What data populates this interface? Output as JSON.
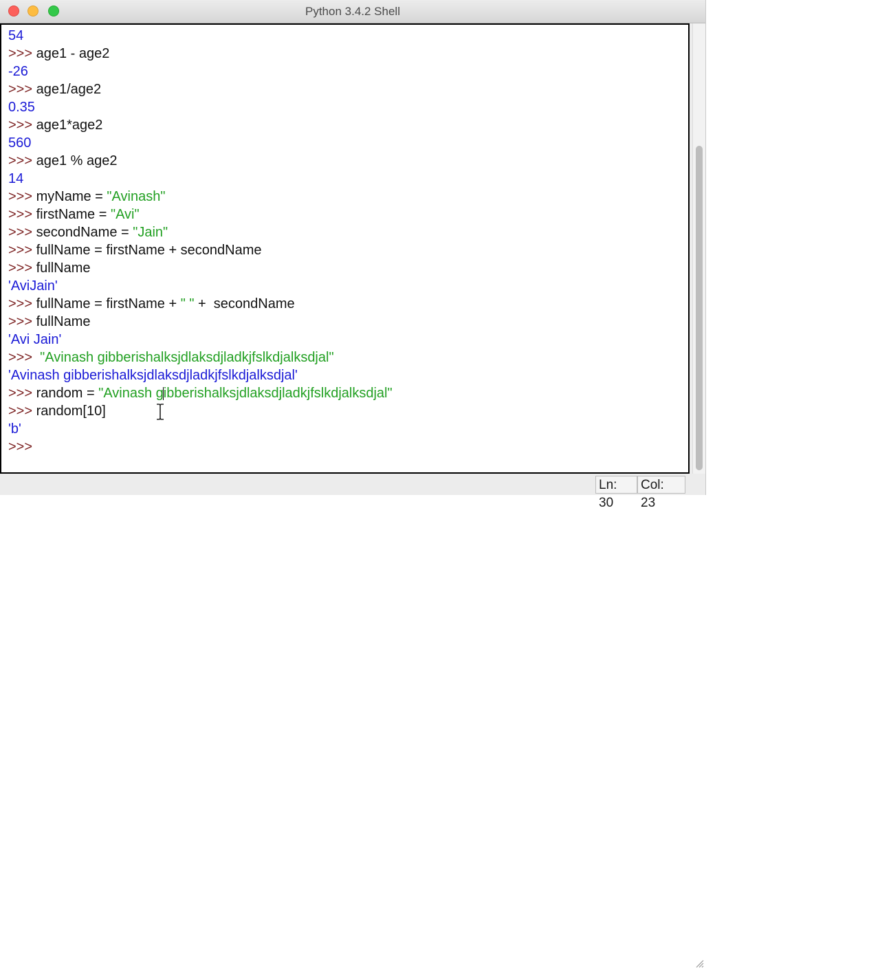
{
  "window": {
    "title": "Python 3.4.2 Shell"
  },
  "shell": {
    "prompt": ">>>",
    "lines": {
      "l1": {
        "out": "54"
      },
      "l2": {
        "code": "age1 - age2"
      },
      "l3": {
        "out": "-26"
      },
      "l4": {
        "code": "age1/age2"
      },
      "l5": {
        "out": "0.35"
      },
      "l6": {
        "code": "age1*age2"
      },
      "l7": {
        "out": "560"
      },
      "l8": {
        "code": "age1 % age2"
      },
      "l9": {
        "out": "14"
      },
      "l10": {
        "code": "myName = ",
        "str": "\"Avinash\""
      },
      "l11": {
        "code": "firstName = ",
        "str": "\"Avi\""
      },
      "l12": {
        "code": "secondName = ",
        "str": "\"Jain\""
      },
      "l13": {
        "code": "fullName = firstName + secondName"
      },
      "l14": {
        "code": "fullName"
      },
      "l15": {
        "out": "'AviJain'"
      },
      "l16": {
        "code_a": "fullName = firstName + ",
        "str": "\" \"",
        "code_b": " +  secondName"
      },
      "l17": {
        "code": "fullName"
      },
      "l18": {
        "out": "'Avi Jain'"
      },
      "l19": {
        "str": "\"Avinash gibberishalksjdlaksdjladkjfslkdjalksdjal\""
      },
      "l20": {
        "out": "'Avinash gibberishalksjdlaksdjladkjfslkdjalksdjal'"
      },
      "l21": {
        "code": "random = ",
        "str_a": "\"Avinash g",
        "str_b": "ibberishalksjdlaksdjladkjfslkdjalksdjal\""
      },
      "l22": {
        "code": "random[10]"
      },
      "l23": {
        "out": "'b'"
      }
    }
  },
  "status": {
    "line": "Ln: 30",
    "col": "Col: 23"
  },
  "colors": {
    "prompt": "#7a1f1f",
    "string": "#22a022",
    "output": "#1a1ad6",
    "code": "#111111"
  },
  "icons": {
    "close": "close-icon",
    "minimize": "minimize-icon",
    "zoom": "zoom-icon",
    "text_cursor": "ibeam-cursor-icon",
    "resize": "resize-grip-icon"
  }
}
